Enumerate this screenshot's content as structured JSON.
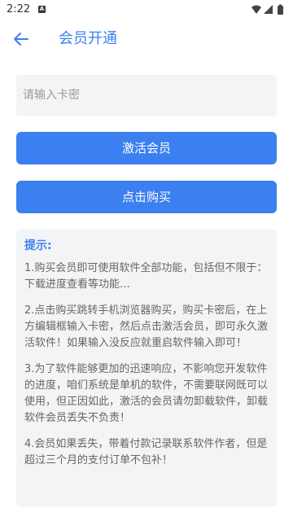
{
  "status_bar": {
    "time": "2:22",
    "notification_glyph": "A",
    "icons": [
      "wifi-icon",
      "signal-icon",
      "battery-icon"
    ]
  },
  "app_bar": {
    "title": "会员开通",
    "back_icon": "arrow-left-icon"
  },
  "card_input": {
    "placeholder": "请输入卡密",
    "value": ""
  },
  "buttons": {
    "activate": "激活会员",
    "buy": "点击购买"
  },
  "tips": {
    "title": "提示:",
    "paragraphs": [
      "1.购买会员即可使用软件全部功能，包括但不限于：下载进度查看等功能…",
      "2.点击购买跳转手机浏览器购买，购买卡密后，在上方编辑框输入卡密，然后点击激活会员，即可永久激活软件！如果输入没反应就重启软件输入即可！",
      "3.为了软件能够更加的迅速响应，不影响您开发软件的进度，咱们系统是单机的软件，不需要联网既可以使用，但正因如此，激活的会员请勿卸载软件，卸载软件会员丢失不负责！",
      "4.会员如果丢失，带着付款记录联系软件作者，但是超过三个月的支付订单不包补！"
    ]
  },
  "colors": {
    "accent": "#3b7ff0",
    "panel_bg": "#f3f4f6",
    "body_text": "#666666"
  }
}
